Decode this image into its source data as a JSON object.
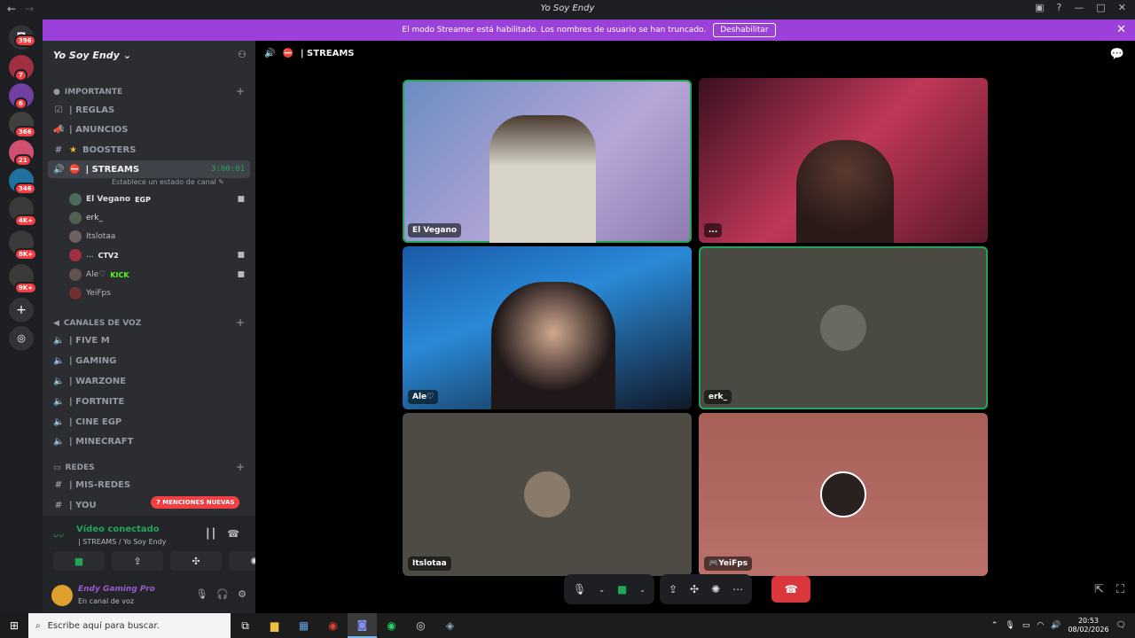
{
  "window": {
    "title": "Yo Soy Endy"
  },
  "banner": {
    "message": "El modo Streamer está habilitado. Los nombres de usuario se han truncado.",
    "button": "Deshabilitar"
  },
  "servers": {
    "badges": [
      "396",
      "7",
      "6",
      "366",
      "21",
      "346",
      "4K+",
      "8K+",
      "9K+"
    ]
  },
  "guild": {
    "name": "Yo Soy Endy"
  },
  "categories": {
    "importante": "IMPORTANTE",
    "voz": "CANALES DE VOZ",
    "redes": "REDES"
  },
  "channels": {
    "reglas": "| REGLAS",
    "anuncios": "| ANUNCIOS",
    "boosters": "BOOSTERS",
    "streams": "| STREAMS",
    "streams_timer": "3:00:01",
    "streams_status": "Establece un estado de canal",
    "fivem": "| FIVE M",
    "gaming": "|  GAMING",
    "warzone": "| WARZONE",
    "fortnite": "| FORTNITE",
    "cine": "| CINE EGP",
    "minecraft": "| MINECRAFT",
    "misredes": "| MIS-REDES",
    "you": "| YOU"
  },
  "members": [
    {
      "name": "El Vegano",
      "tag": "EGP"
    },
    {
      "name": "erk_",
      "tag": ""
    },
    {
      "name": "Itslotaa",
      "tag": ""
    },
    {
      "name": "...",
      "tag": "CTV2"
    },
    {
      "name": "Ale♡",
      "tag": "KICK"
    },
    {
      "name": "YeiFps",
      "tag": ""
    }
  ],
  "mentions": "7 MENCIONES NUEVAS",
  "voice": {
    "status": "Vídeo conectado",
    "channel": "| STREAMS / Yo Soy Endy"
  },
  "user": {
    "name": "Endy Gaming Pro",
    "status": "En canal de voz"
  },
  "stage": {
    "header": "| STREAMS",
    "tiles": [
      {
        "name": "El Vegano"
      },
      {
        "name": "..."
      },
      {
        "name": "Ale♡"
      },
      {
        "name": "erk_"
      },
      {
        "name": "Itslotaa"
      },
      {
        "name": "YeiFps"
      }
    ]
  },
  "taskbar": {
    "search_placeholder": "Escribe aquí para buscar.",
    "time": "20:53",
    "date": "08/02/2026"
  },
  "colors": {
    "banner": "#9b40d8",
    "accent_green": "#23a559",
    "end_call": "#da373c"
  }
}
